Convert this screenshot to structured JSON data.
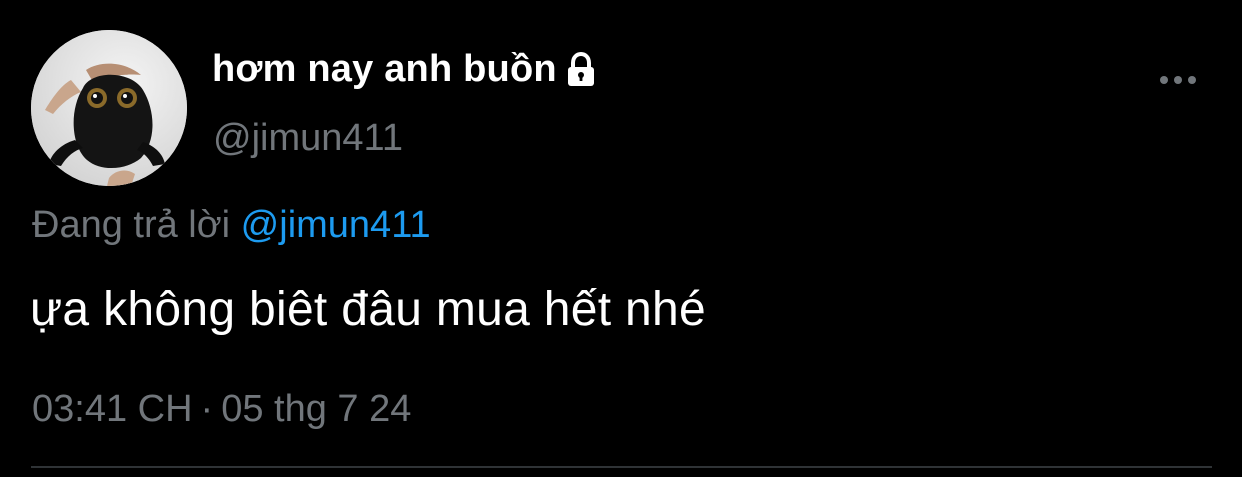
{
  "user": {
    "display_name": "hơm nay anh buồn",
    "handle": "@jimun411",
    "protected_icon": "lock-icon",
    "avatar_description_icon": "avatar-photo"
  },
  "tweet": {
    "reply_prefix": "Đang trả lời",
    "reply_to": "@jimun411",
    "text": "ựa không biêt đâu mua hết nhé",
    "time": "03:41 CH",
    "separator": "·",
    "date": "05 thg 7 24"
  },
  "controls": {
    "more_icon": "more-horizontal-icon"
  },
  "colors": {
    "background": "#000000",
    "primary_text": "#ffffff",
    "secondary_text": "#71767b",
    "accent": "#1d9bf0",
    "divider": "#2f3336"
  }
}
